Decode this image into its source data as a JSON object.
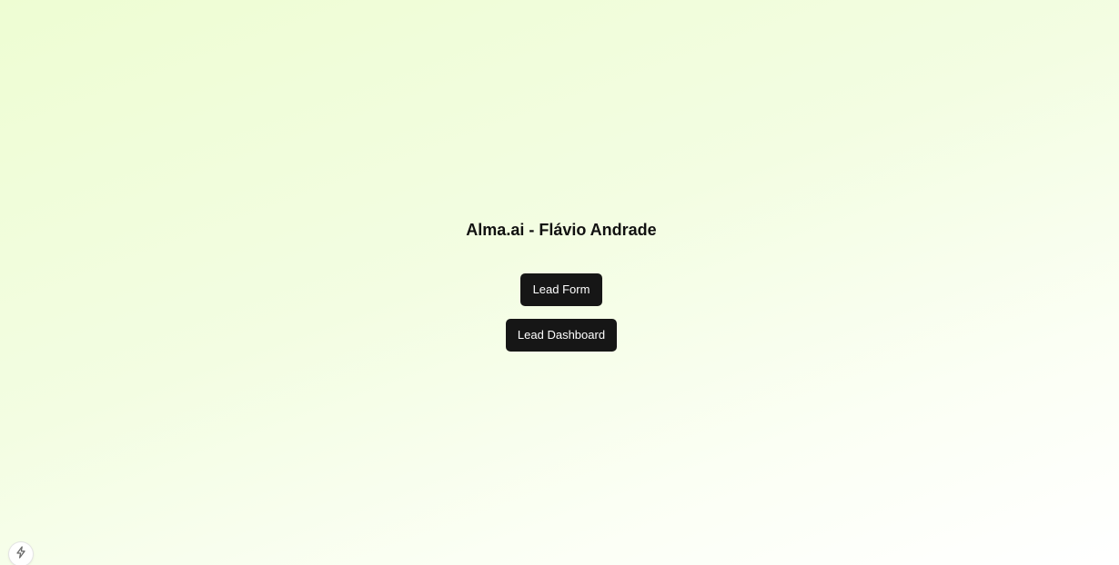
{
  "header": {
    "title": "Alma.ai - Flávio Andrade"
  },
  "nav": {
    "lead_form_label": "Lead Form",
    "lead_dashboard_label": "Lead Dashboard"
  },
  "dev_indicator": {
    "icon": "lightning-bolt-icon"
  },
  "colors": {
    "background_start": "#eefdd3",
    "background_end": "#ffffff",
    "button_bg": "#161616",
    "button_text": "#ffffff",
    "title_text": "#111111"
  }
}
